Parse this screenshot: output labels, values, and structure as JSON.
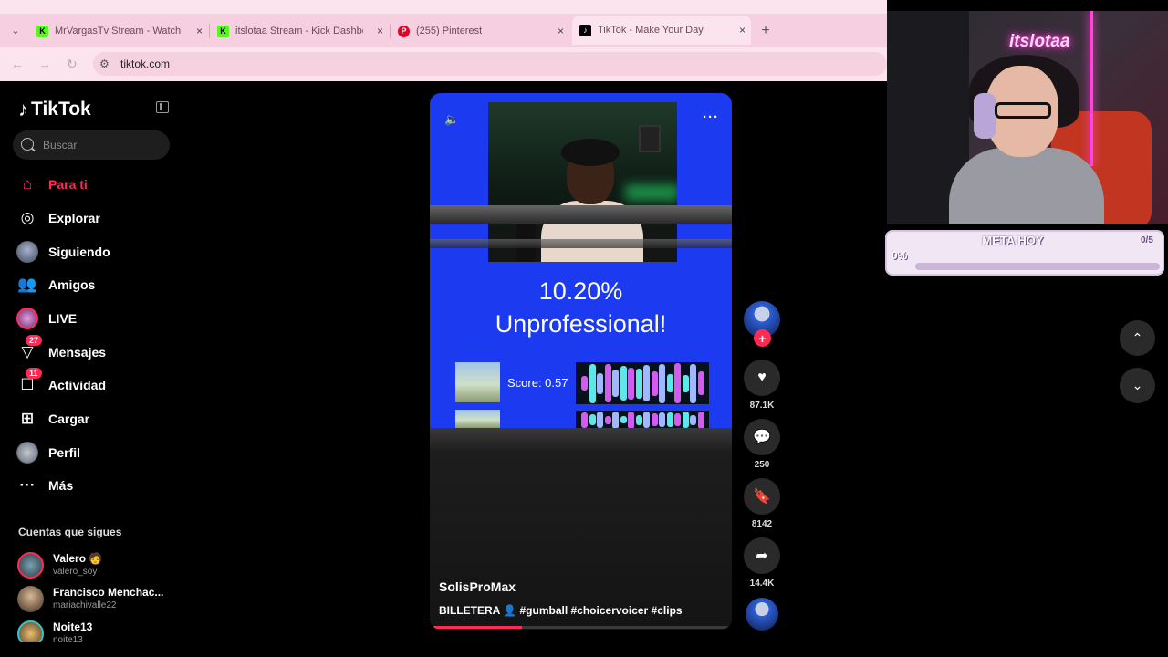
{
  "browser": {
    "tabs": [
      {
        "title": "MrVargasTv Stream - Watch Live",
        "favicon": "kick-icon",
        "active": false
      },
      {
        "title": "itslotaa Stream - Kick Dashboard",
        "favicon": "kick-icon",
        "active": false
      },
      {
        "title": "(255) Pinterest",
        "favicon": "pinterest-icon",
        "active": false
      },
      {
        "title": "TikTok - Make Your Day",
        "favicon": "tiktok-icon",
        "active": true
      }
    ],
    "url": "tiktok.com",
    "new_tab_label": "+",
    "close_label": "×",
    "colors": {
      "chrome_bg": "#fbe4ee",
      "tabstrip_bg": "#f6cfe0"
    }
  },
  "sidebar": {
    "brand": "TikTok",
    "search_placeholder": "Buscar",
    "nav": [
      {
        "label": "Para ti",
        "icon": "home-icon",
        "active": true
      },
      {
        "label": "Explorar",
        "icon": "compass-icon",
        "active": false
      },
      {
        "label": "Siguiendo",
        "icon": "following-avatar-icon",
        "active": false
      },
      {
        "label": "Amigos",
        "icon": "friends-icon",
        "active": false
      },
      {
        "label": "LIVE",
        "icon": "live-icon",
        "active": false
      },
      {
        "label": "Mensajes",
        "icon": "inbox-icon",
        "badge": "27",
        "active": false
      },
      {
        "label": "Actividad",
        "icon": "activity-icon",
        "badge": "11",
        "active": false
      },
      {
        "label": "Cargar",
        "icon": "upload-icon",
        "active": false
      },
      {
        "label": "Perfil",
        "icon": "profile-avatar-icon",
        "active": false
      },
      {
        "label": "Más",
        "icon": "more-icon",
        "active": false
      }
    ],
    "following_title": "Cuentas que sigues",
    "accounts": [
      {
        "name": "Valero 🧑",
        "handle": "valero_soy"
      },
      {
        "name": "Francisco Menchac...",
        "handle": "mariachivalle22"
      },
      {
        "name": "Noite13",
        "handle": "noite13"
      }
    ],
    "accent": "#fe2c55"
  },
  "video": {
    "overlay_percent": "10.20%",
    "overlay_verdict": "Unprofessional!",
    "score_label": "Score: 0.57",
    "author": "SolisProMax",
    "caption": "BILLETERA 👤 #gumball #choicervoicer #clips",
    "progress": 0.3,
    "bg_color": "#1c3aef"
  },
  "actions": {
    "likes": "87.1K",
    "comments": "250",
    "saves": "8142",
    "shares": "14.4K"
  },
  "overlay": {
    "streamer_logo": "itslotaa",
    "goal_title": "META HOY",
    "goal_count": "0/5",
    "goal_percent": "0%",
    "goal_progress": 0.0
  }
}
